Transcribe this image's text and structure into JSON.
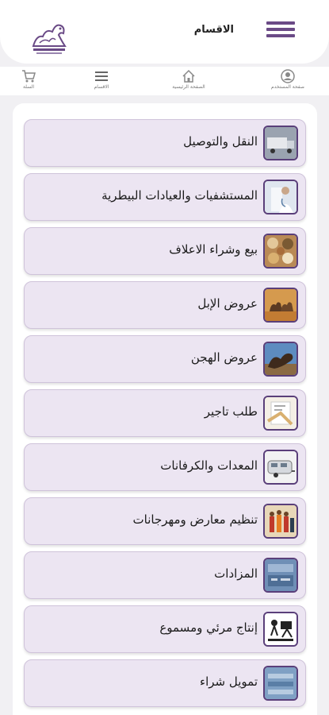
{
  "header": {
    "title": "الاقسام",
    "logo_icon": "camel-logo"
  },
  "nav": {
    "items": [
      {
        "label": "صفحة المستخدم",
        "icon": "user-icon"
      },
      {
        "label": "الصفحة الرئيسية",
        "icon": "home-icon"
      },
      {
        "label": "الاقسام",
        "icon": "list-icon"
      },
      {
        "label": "السلة",
        "icon": "cart-icon"
      }
    ]
  },
  "categories": [
    {
      "label": "النقل والتوصيل",
      "thumb": "truck"
    },
    {
      "label": "المستشفيات والعيادات البيطرية",
      "thumb": "vet"
    },
    {
      "label": "بيع وشراء الاعلاف",
      "thumb": "feed"
    },
    {
      "label": "عروض الإبل",
      "thumb": "camels"
    },
    {
      "label": "عروض الهجن",
      "thumb": "racing-camel"
    },
    {
      "label": "طلب تاجير",
      "thumb": "rent"
    },
    {
      "label": "المعدات والكرفانات",
      "thumb": "caravan"
    },
    {
      "label": "تنظيم معارض ومهرجانات",
      "thumb": "festival"
    },
    {
      "label": "المزادات",
      "thumb": "auction"
    },
    {
      "label": "إنتاج مرئي ومسموع",
      "thumb": "media"
    },
    {
      "label": "تمويل شراء",
      "thumb": "finance"
    }
  ],
  "colors": {
    "accent": "#6a4a86",
    "item_bg": "#ece5f2",
    "page_bg": "#f1f0f3"
  }
}
